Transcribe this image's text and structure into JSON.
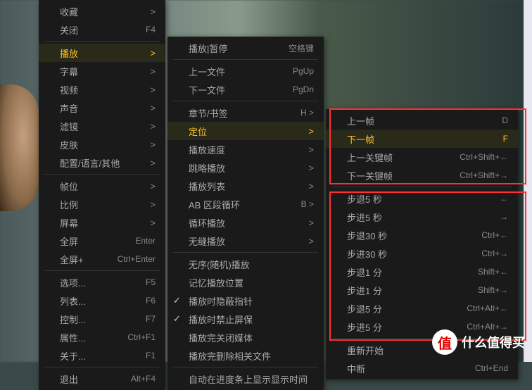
{
  "menu1": [
    {
      "label": "收藏",
      "type": "submenu"
    },
    {
      "label": "关闭",
      "shortcut": "F4"
    },
    {
      "type": "sep"
    },
    {
      "label": "播放",
      "type": "submenu",
      "selected": true
    },
    {
      "label": "字幕",
      "type": "submenu"
    },
    {
      "label": "视频",
      "type": "submenu"
    },
    {
      "label": "声音",
      "type": "submenu"
    },
    {
      "label": "滤镜",
      "type": "submenu"
    },
    {
      "label": "皮肤",
      "type": "submenu"
    },
    {
      "label": "配置/语言/其他",
      "type": "submenu"
    },
    {
      "type": "sep"
    },
    {
      "label": "帧位",
      "type": "submenu"
    },
    {
      "label": "比例",
      "type": "submenu"
    },
    {
      "label": "屏幕",
      "type": "submenu"
    },
    {
      "label": "全屏",
      "shortcut": "Enter"
    },
    {
      "label": "全屏+",
      "shortcut": "Ctrl+Enter"
    },
    {
      "type": "sep"
    },
    {
      "label": "选项...",
      "shortcut": "F5"
    },
    {
      "label": "列表...",
      "shortcut": "F6"
    },
    {
      "label": "控制...",
      "shortcut": "F7"
    },
    {
      "label": "属性...",
      "shortcut": "Ctrl+F1"
    },
    {
      "label": "关于...",
      "shortcut": "F1"
    },
    {
      "type": "sep"
    },
    {
      "label": "退出",
      "shortcut": "Alt+F4"
    }
  ],
  "menu2": [
    {
      "label": "播放|暂停",
      "shortcut": "空格键"
    },
    {
      "type": "sep"
    },
    {
      "label": "上一文件",
      "shortcut": "PgUp"
    },
    {
      "label": "下一文件",
      "shortcut": "PgDn"
    },
    {
      "type": "sep"
    },
    {
      "label": "章节/书签",
      "shortcut": "H >"
    },
    {
      "label": "定位",
      "type": "submenu",
      "selected": true
    },
    {
      "label": "播放速度",
      "type": "submenu"
    },
    {
      "label": "跳略播放",
      "type": "submenu"
    },
    {
      "label": "播放列表",
      "type": "submenu"
    },
    {
      "label": "AB 区段循环",
      "shortcut": "B >"
    },
    {
      "label": "循环播放",
      "type": "submenu"
    },
    {
      "label": "无缝播放",
      "type": "submenu"
    },
    {
      "type": "sep"
    },
    {
      "label": "无序(随机)播放"
    },
    {
      "label": "记忆播放位置"
    },
    {
      "label": "播放时隐蔽指针",
      "checked": true
    },
    {
      "label": "播放时禁止屏保",
      "checked": true
    },
    {
      "label": "播放完关闭媒体"
    },
    {
      "label": "播放完删除相关文件"
    },
    {
      "type": "sep"
    },
    {
      "label": "自动在进度条上显示显示时间"
    }
  ],
  "menu3": [
    {
      "label": "上一帧",
      "shortcut": "D"
    },
    {
      "label": "下一帧",
      "shortcut": "F",
      "selected": true
    },
    {
      "label": "上一关键帧",
      "shortcut": "Ctrl+Shift+←"
    },
    {
      "label": "下一关键帧",
      "shortcut": "Ctrl+Shift+→"
    },
    {
      "type": "sep"
    },
    {
      "label": "步退5 秒",
      "shortcut": "←"
    },
    {
      "label": "步进5 秒",
      "shortcut": "→"
    },
    {
      "label": "步退30 秒",
      "shortcut": "Ctrl+←"
    },
    {
      "label": "步进30 秒",
      "shortcut": "Ctrl+→"
    },
    {
      "label": "步退1 分",
      "shortcut": "Shift+←"
    },
    {
      "label": "步进1 分",
      "shortcut": "Shift+→"
    },
    {
      "label": "步退5 分",
      "shortcut": "Ctrl+Alt+←"
    },
    {
      "label": "步进5 分",
      "shortcut": "Ctrl+Alt+→"
    },
    {
      "type": "sep"
    },
    {
      "label": "重新开始"
    },
    {
      "label": "中断",
      "shortcut": "Ctrl+End"
    }
  ],
  "logo": {
    "symbol": "值",
    "text": "什么值得买"
  }
}
